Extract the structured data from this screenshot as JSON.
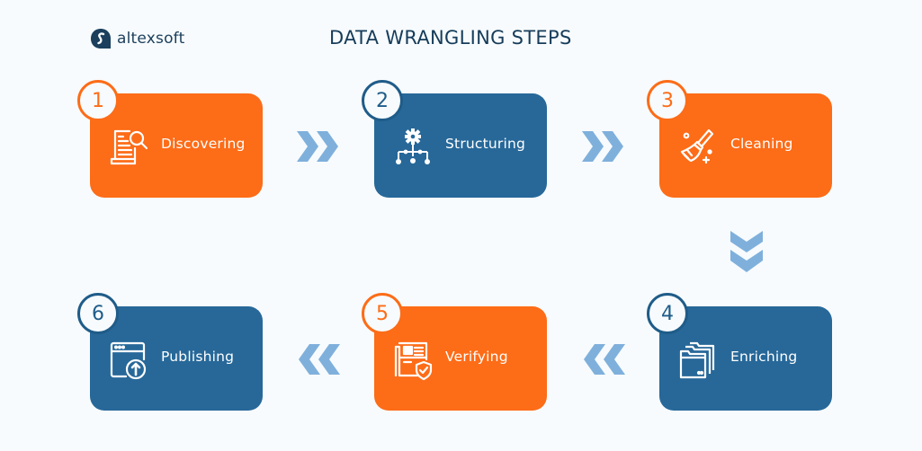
{
  "brand": {
    "name": "altexsoft",
    "color": "#1b3f5c"
  },
  "title": "DATA WRANGLING STEPS",
  "colors": {
    "orange": "#fd6c17",
    "blue": "#276899",
    "arrow": "#7fb0dc",
    "background": "#f7fbfd"
  },
  "steps": [
    {
      "number": "1",
      "label": "Discovering",
      "icon": "document-search-icon",
      "color": "orange"
    },
    {
      "number": "2",
      "label": "Structuring",
      "icon": "gear-hierarchy-icon",
      "color": "blue"
    },
    {
      "number": "3",
      "label": "Cleaning",
      "icon": "brush-icon",
      "color": "orange"
    },
    {
      "number": "4",
      "label": "Enriching",
      "icon": "folders-icon",
      "color": "blue"
    },
    {
      "number": "5",
      "label": "Verifying",
      "icon": "document-shield-icon",
      "color": "orange"
    },
    {
      "number": "6",
      "label": "Publishing",
      "icon": "browser-upload-icon",
      "color": "blue"
    }
  ],
  "connectors": [
    {
      "from": "1",
      "to": "2",
      "direction": "right"
    },
    {
      "from": "2",
      "to": "3",
      "direction": "right"
    },
    {
      "from": "3",
      "to": "4",
      "direction": "down"
    },
    {
      "from": "4",
      "to": "5",
      "direction": "left"
    },
    {
      "from": "5",
      "to": "6",
      "direction": "left"
    }
  ]
}
